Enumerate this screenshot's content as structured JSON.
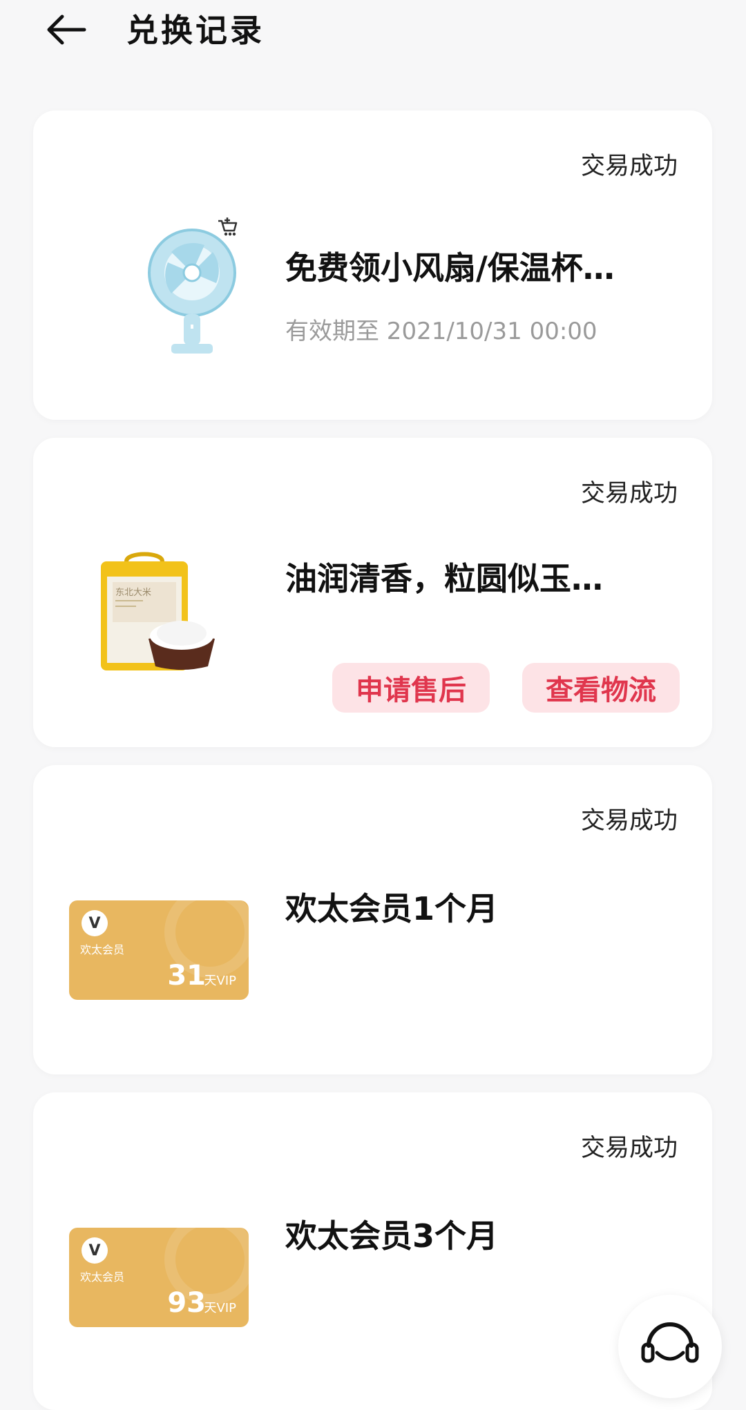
{
  "header": {
    "title": "兑换记录"
  },
  "records": [
    {
      "status": "交易成功",
      "title": "免费领小风扇/保温杯…",
      "validity": "有效期至 2021/10/31 00:00",
      "image": "handheld-fan"
    },
    {
      "status": "交易成功",
      "title": "油润清香，粒圆似玉…",
      "image": "rice-bag",
      "rice_label": "东北大米",
      "buttons": {
        "after_sales": "申请售后",
        "logistics": "查看物流"
      }
    },
    {
      "status": "交易成功",
      "title": "欢太会员1个月",
      "image": "vip-card",
      "vip": {
        "name": "欢太会员",
        "days": "31",
        "unit": "天VIP",
        "badge": "V"
      }
    },
    {
      "status": "交易成功",
      "title": "欢太会员3个月",
      "image": "vip-card",
      "vip": {
        "name": "欢太会员",
        "days": "93",
        "unit": "天VIP",
        "badge": "V"
      }
    }
  ],
  "colors": {
    "background": "#f7f7f8",
    "card": "#ffffff",
    "accent_text": "#e0364d",
    "accent_bg": "#fde3e6",
    "vip_gold": "#e8b760",
    "muted_text": "#9a9a9a"
  },
  "icons": {
    "back": "arrow-left-icon",
    "cart": "shopping-cart-icon",
    "support": "headset-icon"
  }
}
